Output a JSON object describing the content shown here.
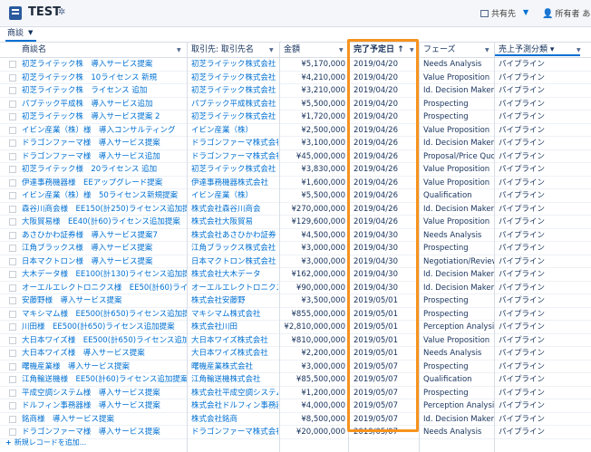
{
  "app": {
    "title": "TEST",
    "settings_icon": "gear-icon"
  },
  "toolbar": {
    "share_label": "共有先",
    "owner_label": "所有者",
    "owner_value": "あな"
  },
  "tabbar": {
    "tab_label": "商談"
  },
  "columns": [
    {
      "label": "商談名"
    },
    {
      "label": "取引先: 取引先名"
    },
    {
      "label": "金額"
    },
    {
      "label": "完了予定日 ↑"
    },
    {
      "label": "フェーズ"
    },
    {
      "label": "売上予測分類 ▾"
    }
  ],
  "rows": [
    [
      "初芝ライテック株　導入サービス提案",
      "初芝ライテック株式会社",
      "¥5,170,000",
      "2019/04/20",
      "Needs Analysis",
      "パイプライン"
    ],
    [
      "初芝ライテック株　10ライセンス 新規",
      "初芝ライテック株式会社",
      "¥4,210,000",
      "2019/04/20",
      "Value Proposition",
      "パイプライン"
    ],
    [
      "初芝ライテック株　ライセンス 追加",
      "初芝ライテック株式会社",
      "¥3,210,000",
      "2019/04/20",
      "Id. Decision Makers",
      "パイプライン"
    ],
    [
      "パブテック平成株　導入サービス追加",
      "パブテック平成株式会社",
      "¥5,500,000",
      "2019/04/20",
      "Prospecting",
      "パイプライン"
    ],
    [
      "初芝ライテック株　導入サービス提案 2",
      "初芝ライテック株式会社",
      "¥1,720,000",
      "2019/04/20",
      "Prospecting",
      "パイプライン"
    ],
    [
      "イビン産業（株）様　導入コンサルティング",
      "イビン産業（株）",
      "¥2,500,000",
      "2019/04/26",
      "Value Proposition",
      "パイプライン"
    ],
    [
      "ドラゴンファーマ様　導入サービス提案",
      "ドラゴンファーマ株式会社",
      "¥3,100,000",
      "2019/04/26",
      "Id. Decision Makers",
      "パイプライン"
    ],
    [
      "ドラゴンファーマ様　導入サービス追加",
      "ドラゴンファーマ株式会社",
      "¥45,000,000",
      "2019/04/26",
      "Proposal/Price Quote",
      "パイプライン"
    ],
    [
      "初芝ライテック様　20ライセンス 追加",
      "初芝ライテック株式会社",
      "¥3,830,000",
      "2019/04/26",
      "Value Proposition",
      "パイプライン"
    ],
    [
      "伊達事務機器様　EEアップグレード提案",
      "伊達事務機器株式会社",
      "¥1,600,000",
      "2019/04/26",
      "Value Proposition",
      "パイプライン"
    ],
    [
      "イビン産業（株）様　50ライセンス新規提案",
      "イビン産業（株）",
      "¥5,500,000",
      "2019/04/26",
      "Qualification",
      "パイプライン"
    ],
    [
      "森谷川商会様　EE150(計250)ライセンス追加提案",
      "株式会社森谷川商会",
      "¥270,000,000",
      "2019/04/26",
      "Id. Decision Makers",
      "パイプライン"
    ],
    [
      "大阪貿易様　EE40(計60)ライセンス追加提案",
      "株式会社大阪貿易",
      "¥129,600,000",
      "2019/04/26",
      "Value Proposition",
      "パイプライン"
    ],
    [
      "あさひかわ証券様　導入サービス提案7",
      "株式会社あさひかわ証券",
      "¥4,500,000",
      "2019/04/30",
      "Needs Analysis",
      "パイプライン"
    ],
    [
      "江角ブラックス様　導入サービス提案",
      "江角ブラックス株式会社",
      "¥3,000,000",
      "2019/04/30",
      "Prospecting",
      "パイプライン"
    ],
    [
      "日本マクトロン様　導入サービス提案",
      "日本マクトロン株式会社",
      "¥3,000,000",
      "2019/04/30",
      "Negotiation/Review",
      "パイプライン"
    ],
    [
      "大木データ様　EE100(計130)ライセンス追加提案",
      "株式会社大木データ",
      "¥162,000,000",
      "2019/04/30",
      "Id. Decision Makers",
      "パイプライン"
    ],
    [
      "オーエルエレクトロニクス様　EE50(計60)ライセンス...",
      "オーエルエレクトロニクス株...",
      "¥90,000,000",
      "2019/04/30",
      "Id. Decision Makers",
      "パイプライン"
    ],
    [
      "安藤野様　導入サービス提案",
      "株式会社安藤野",
      "¥3,500,000",
      "2019/05/01",
      "Prospecting",
      "パイプライン"
    ],
    [
      "マキシマム様　EE500(計650)ライセンス追加提案",
      "マキシマム株式会社",
      "¥855,000,000",
      "2019/05/01",
      "Prospecting",
      "パイプライン"
    ],
    [
      "川田様　EE500(計650)ライセンス追加提案",
      "株式会社川田",
      "¥2,810,000,000",
      "2019/05/01",
      "Perception Analysis",
      "パイプライン"
    ],
    [
      "大日本ワイズ様　EE500(計650)ライセンス追加提案",
      "大日本ワイズ株式会社",
      "¥810,000,000",
      "2019/05/01",
      "Value Proposition",
      "パイプライン"
    ],
    [
      "大日本ワイズ様　導入サービス提案",
      "大日本ワイズ株式会社",
      "¥2,200,000",
      "2019/05/01",
      "Needs Analysis",
      "パイプライン"
    ],
    [
      "曙機産業様　導入サービス提案",
      "曙機産業株式会社",
      "¥3,000,000",
      "2019/05/07",
      "Prospecting",
      "パイプライン"
    ],
    [
      "江角輸送機様　EE50(計60)ライセンス追加提案",
      "江角輸送機株式会社",
      "¥85,500,000",
      "2019/05/07",
      "Qualification",
      "パイプライン"
    ],
    [
      "平成空調システム様　導入サービス提案",
      "株式会社平成空調システム",
      "¥1,200,000",
      "2019/05/07",
      "Prospecting",
      "パイプライン"
    ],
    [
      "ドルフィン事務器様　導入サービス提案",
      "株式会社ドルフィン事務器",
      "¥4,000,000",
      "2019/05/07",
      "Perception Analysis",
      "パイプライン"
    ],
    [
      "銘商様　導入サービス提案",
      "株式会社銘商",
      "¥8,500,000",
      "2019/05/07",
      "Id. Decision Makers",
      "パイプライン"
    ],
    [
      "ドラゴンファーマ様　導入サービス提案",
      "ドラゴンファーマ株式会社",
      "¥20,000,000",
      "2019/05/07",
      "Needs Analysis",
      "パイプライン"
    ]
  ],
  "footer": {
    "new_record_label": "新規レコードを追加..."
  },
  "colors": {
    "accent": "#0070d2",
    "highlight": "#f7931e",
    "header_bg": "#f4f6f9"
  }
}
